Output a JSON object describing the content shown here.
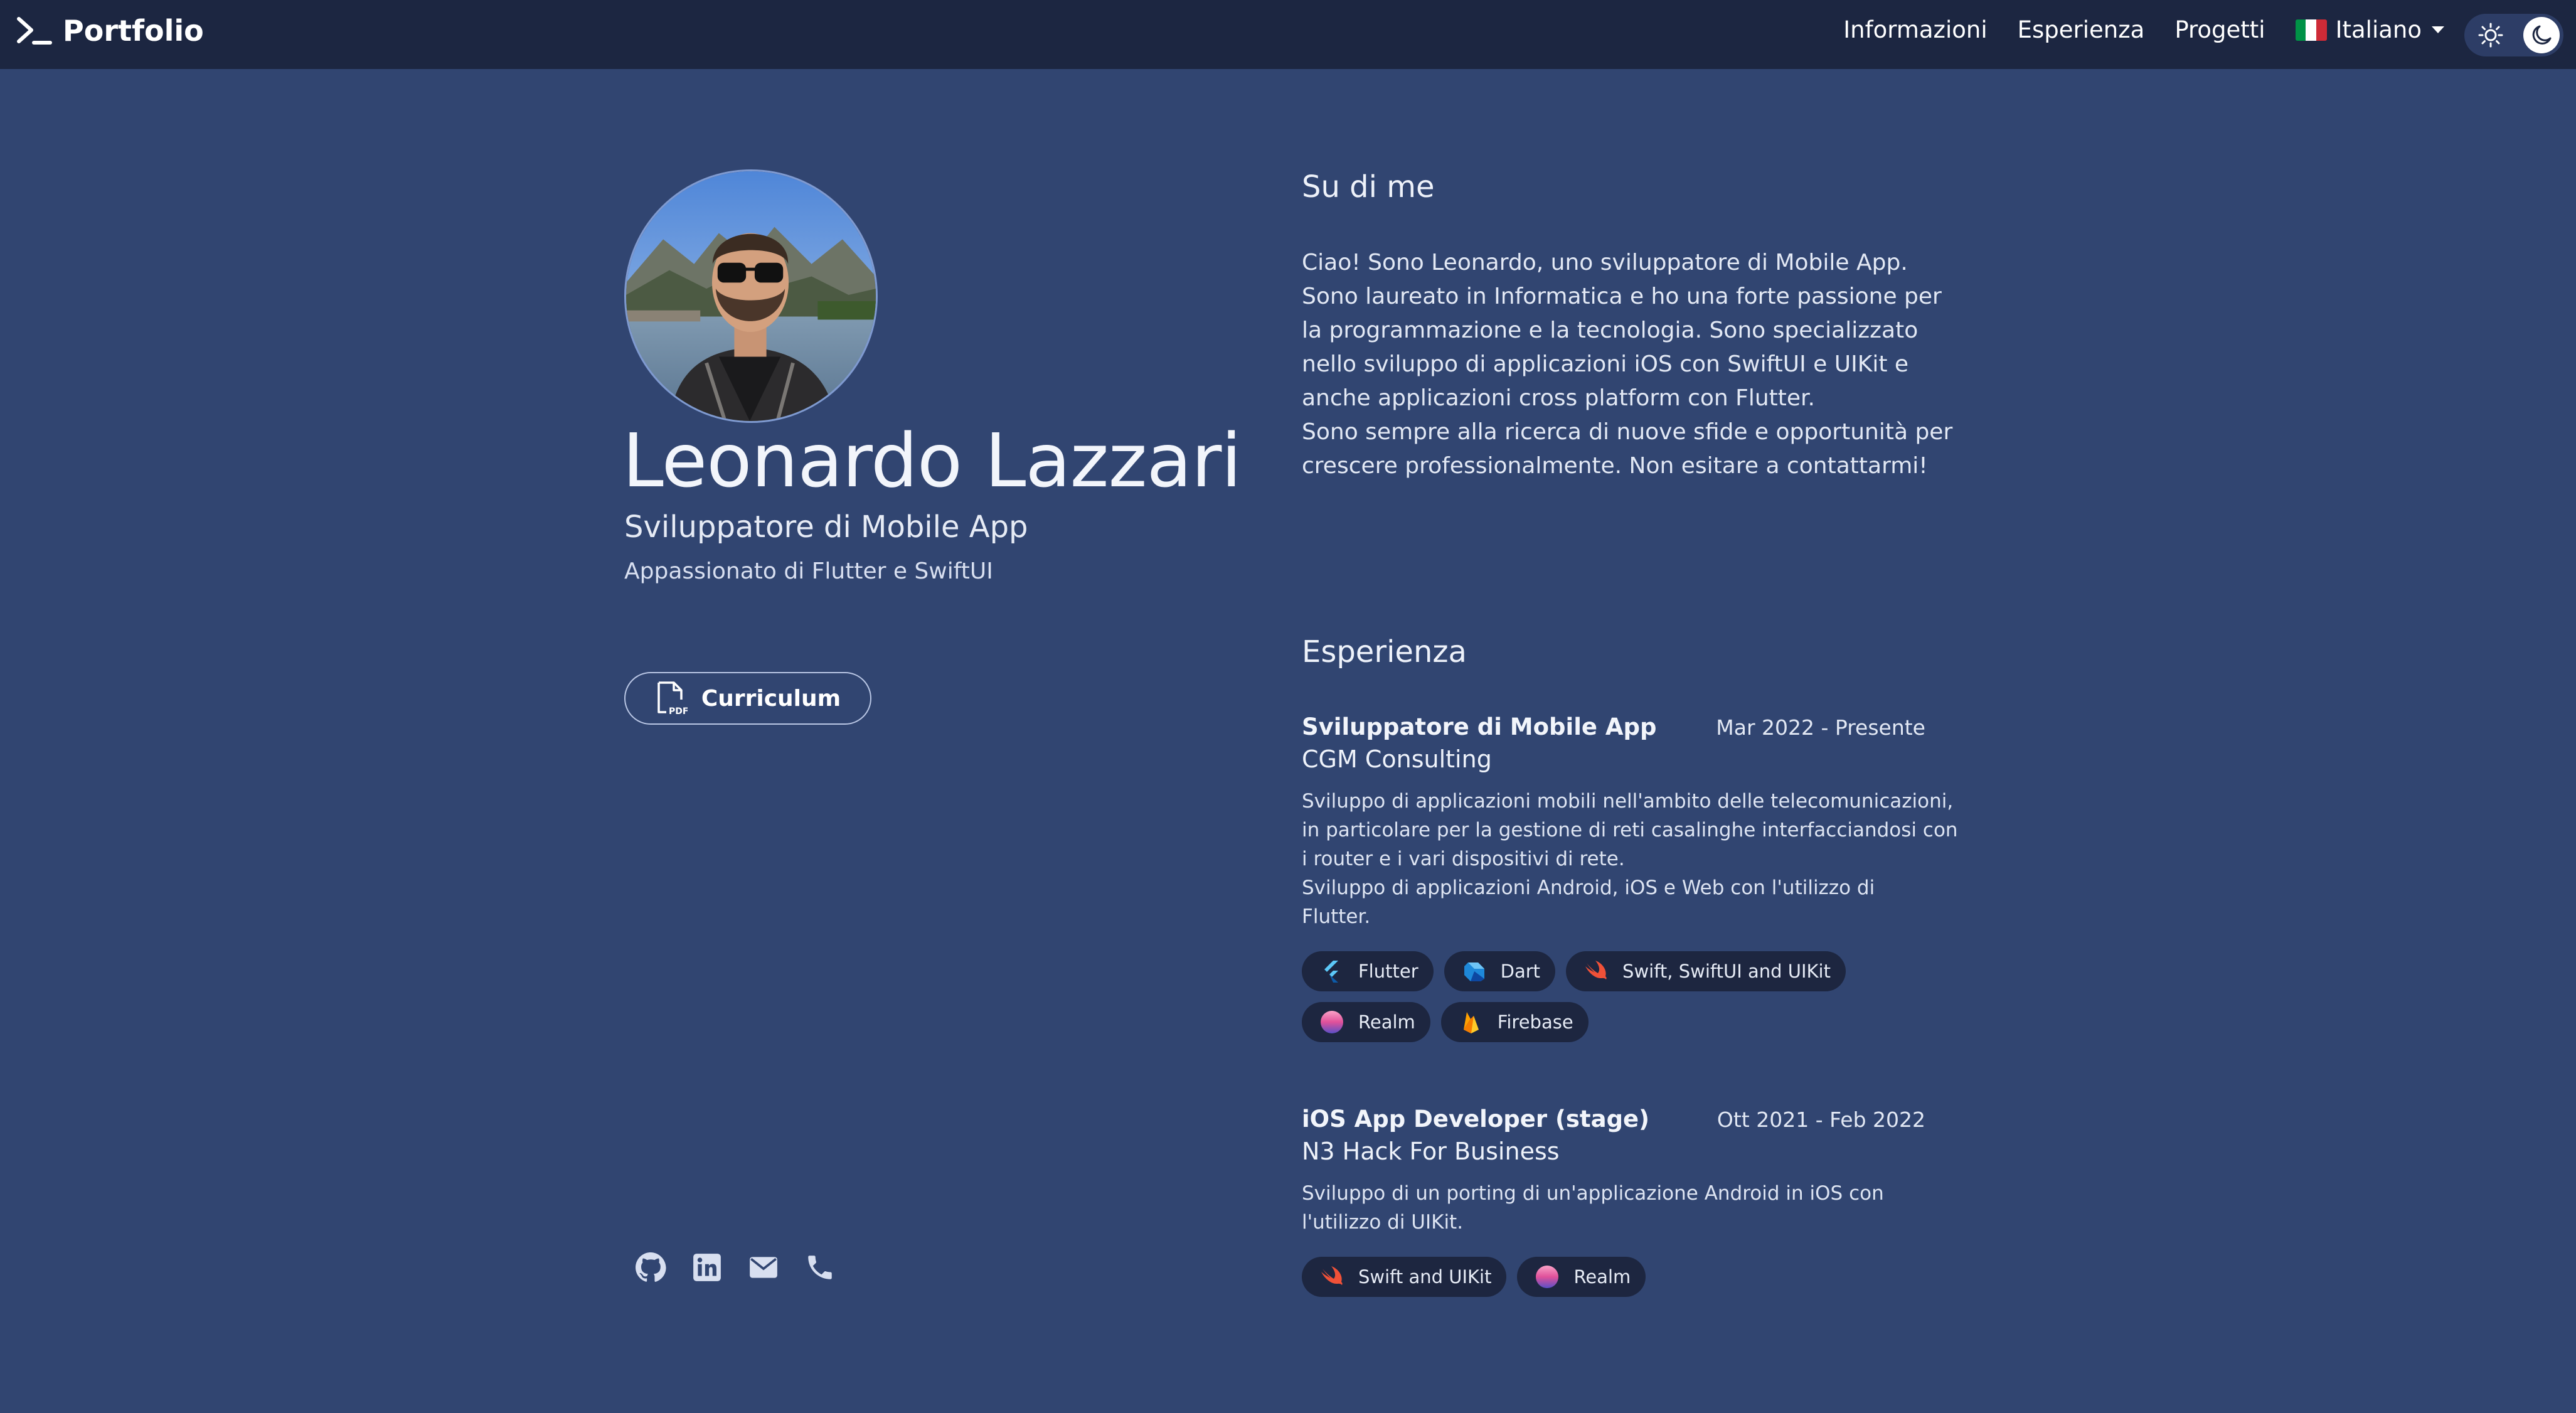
{
  "navbar": {
    "brand": "Portfolio",
    "links": [
      "Informazioni",
      "Esperienza",
      "Progetti"
    ],
    "language": "Italiano",
    "flag_colors": [
      "#009246",
      "#ffffff",
      "#ce2b37"
    ]
  },
  "profile": {
    "name": "Leonardo Lazzari",
    "role": "Sviluppatore di Mobile App",
    "tagline": "Appassionato di Flutter e SwiftUI",
    "cv_label": "Curriculum",
    "social_icons": [
      "github-icon",
      "linkedin-icon",
      "email-icon",
      "phone-icon"
    ]
  },
  "about": {
    "title": "Su di me",
    "lines": [
      "Ciao! Sono Leonardo, uno sviluppatore di Mobile App.",
      "Sono laureato in Informatica e ho una forte passione per",
      "la programmazione e la tecnologia. Sono specializzato",
      "nello sviluppo di applicazioni iOS con SwiftUI e UIKit e",
      "anche applicazioni cross platform con Flutter.",
      "Sono sempre alla ricerca di nuove sfide e opportunità per",
      "crescere professionalmente. Non esitare a contattarmi!"
    ]
  },
  "experience": {
    "title": "Esperienza",
    "jobs": [
      {
        "title": "Sviluppatore di Mobile App",
        "date": "Mar 2022 - Presente",
        "company": "CGM Consulting",
        "desc_lines": [
          "Sviluppo di applicazioni mobili nell'ambito delle telecomunicazioni,",
          "in particolare per la gestione di reti casalinghe interfacciandosi con",
          "i router e i vari dispositivi di rete.",
          "Sviluppo di applicazioni Android, iOS e Web con l'utilizzo di",
          "Flutter."
        ],
        "tags": [
          "Flutter",
          "Dart",
          "Swift, SwiftUI and UIKit",
          "Realm",
          "Firebase"
        ]
      },
      {
        "title": "iOS App Developer (stage)",
        "date": "Ott 2021 - Feb 2022",
        "company": "N3 Hack For Business",
        "desc_lines": [
          "Sviluppo di un porting di un'applicazione Android in iOS con",
          "l'utilizzo di UIKit."
        ],
        "tags": [
          "Swift and UIKit",
          "Realm"
        ]
      }
    ]
  },
  "colors": {
    "background": "#314571",
    "navbar": "#1c2641",
    "tag_background": "#1d2640"
  }
}
